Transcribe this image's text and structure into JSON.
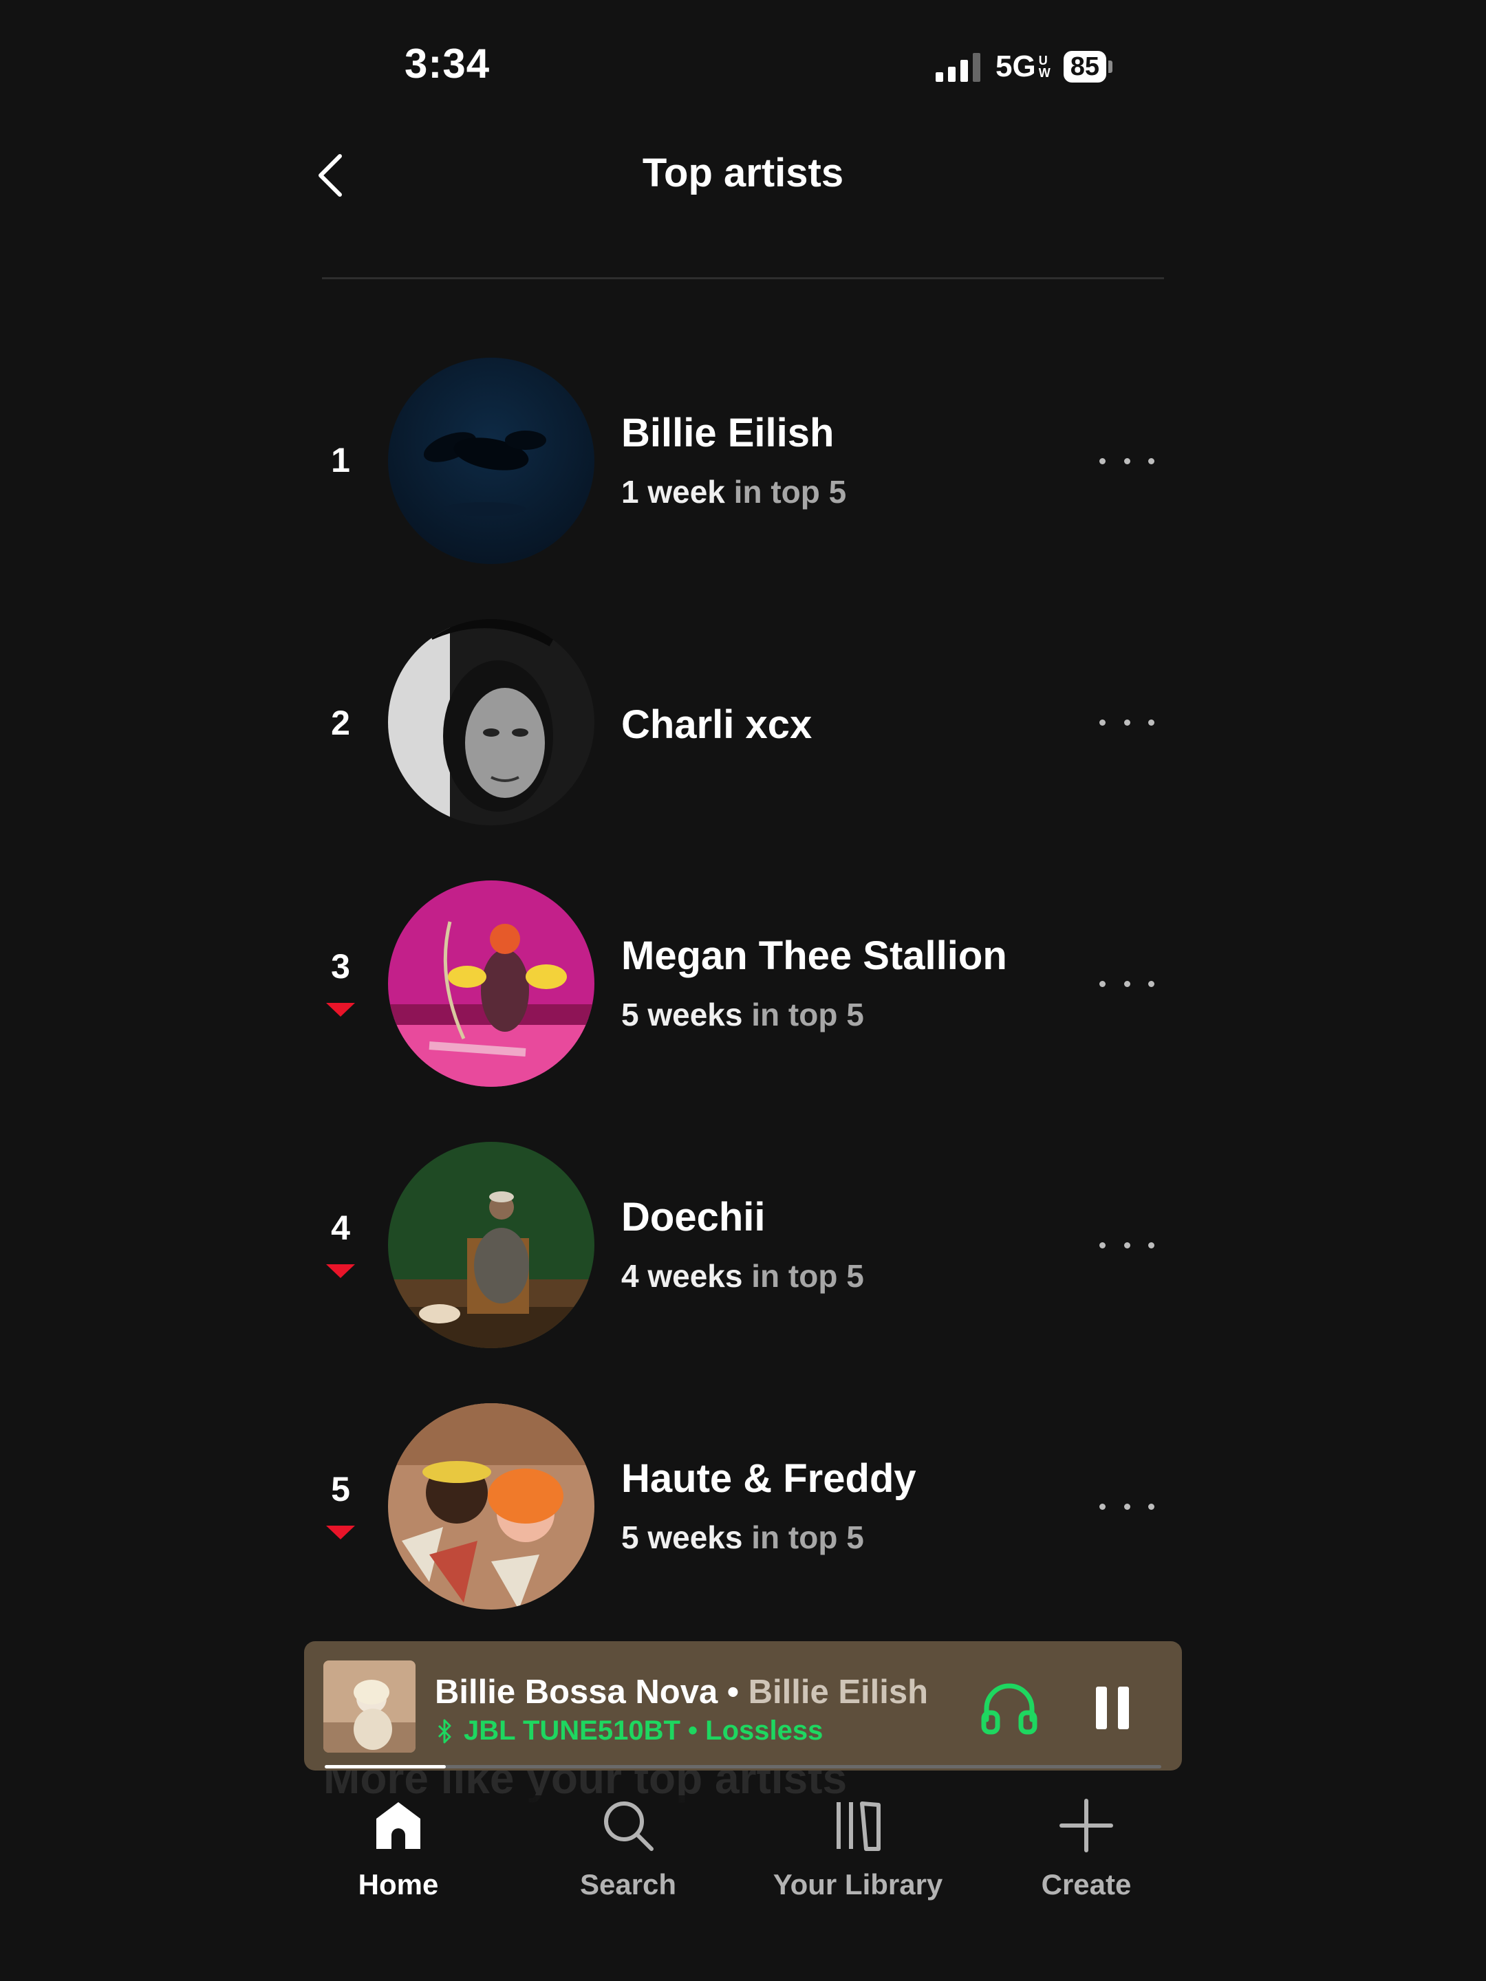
{
  "status_bar": {
    "time": "3:34",
    "network": "5G",
    "network_badge": "UW",
    "battery": "85"
  },
  "header": {
    "title": "Top artists",
    "back_icon": "chevron-left-icon"
  },
  "artists": [
    {
      "rank": "1",
      "name": "Billie Eilish",
      "weeks": "1 week",
      "suffix": " in top 5",
      "trend": "none"
    },
    {
      "rank": "2",
      "name": "Charli xcx",
      "weeks": "",
      "suffix": "",
      "trend": "none"
    },
    {
      "rank": "3",
      "name": "Megan Thee Stallion",
      "weeks": "5 weeks",
      "suffix": " in top 5",
      "trend": "down"
    },
    {
      "rank": "4",
      "name": "Doechii",
      "weeks": "4 weeks",
      "suffix": " in top 5",
      "trend": "down"
    },
    {
      "rank": "5",
      "name": "Haute & Freddy",
      "weeks": "5 weeks",
      "suffix": " in top 5",
      "trend": "down"
    }
  ],
  "now_playing": {
    "track": "Billie Bossa Nova",
    "separator": " • ",
    "artist": "Billie Eilish",
    "device": "JBL TUNE510BT • Lossless",
    "progress": 0.145,
    "colors": {
      "background": "#5e4f3c",
      "accent": "#1ed760"
    }
  },
  "peek_section": {
    "title": "More like your top artists"
  },
  "bottom_nav": [
    {
      "label": "Home",
      "icon": "home-icon",
      "active": true
    },
    {
      "label": "Search",
      "icon": "search-icon",
      "active": false
    },
    {
      "label": "Your Library",
      "icon": "library-icon",
      "active": false
    },
    {
      "label": "Create",
      "icon": "plus-icon",
      "active": false
    }
  ],
  "colors": {
    "background": "#121212",
    "trend_down": "#e91429",
    "secondary_text": "#a7a7a7"
  }
}
